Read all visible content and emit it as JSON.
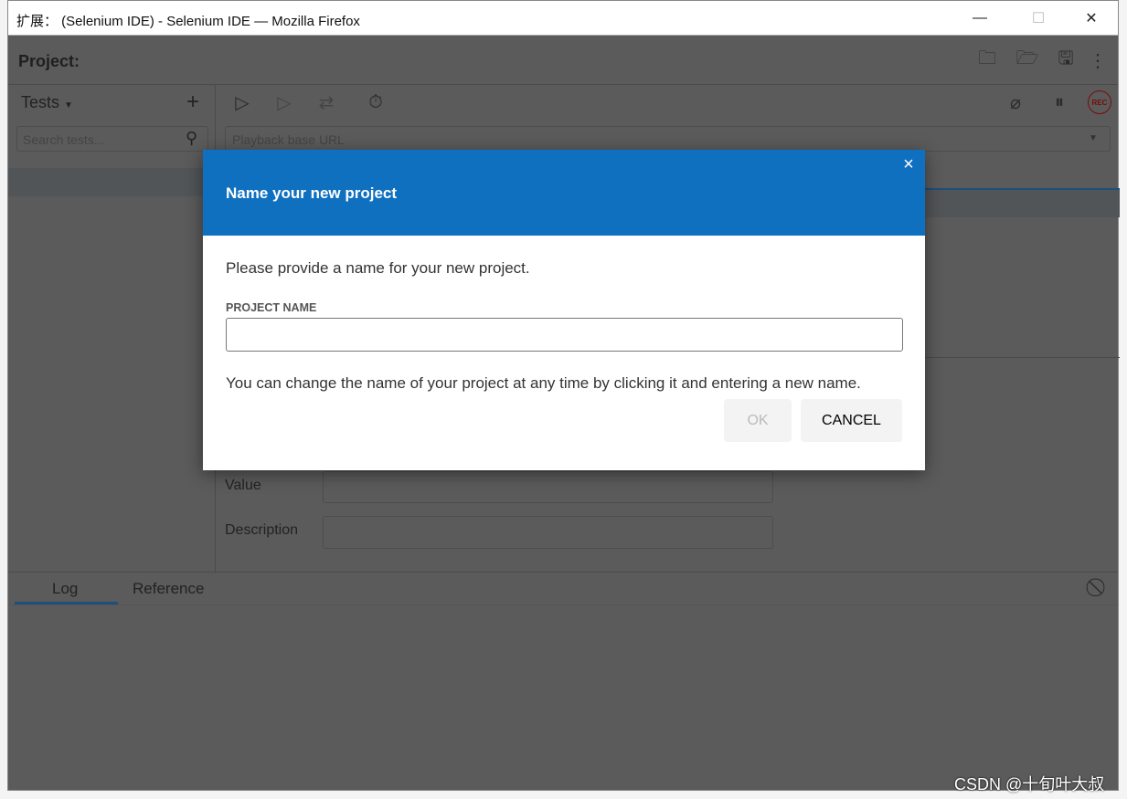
{
  "window": {
    "title": "扩展： (Selenium IDE) - Selenium IDE — Mozilla Firefox",
    "minimize": "—",
    "maximize": "☐",
    "close": "✕"
  },
  "header": {
    "project_label": "Project:",
    "icons": [
      "new-project-icon",
      "open-project-icon",
      "save-project-icon",
      "more-icon"
    ]
  },
  "tests": {
    "title": "Tests",
    "add": "+",
    "search_placeholder": "Search tests..."
  },
  "toolbar": {
    "icons": [
      "run-all-icon",
      "run-icon",
      "step-icon",
      "speed-icon",
      "disable-breakpoints-icon",
      "pause-icon",
      "record-icon"
    ],
    "rec": "REC"
  },
  "url": {
    "placeholder": "Playback base URL"
  },
  "command": {
    "value_label": "Value",
    "description_label": "Description"
  },
  "bottom": {
    "tabs": [
      {
        "label": "Log",
        "active": true
      },
      {
        "label": "Reference",
        "active": false
      }
    ]
  },
  "dialog": {
    "title": "Name your new project",
    "close": "×",
    "prompt": "Please provide a name for your new project.",
    "field_label": "PROJECT NAME",
    "field_value": "",
    "hint": "You can change the name of your project at any time by clicking it and entering a new name.",
    "ok": "OK",
    "cancel": "CANCEL",
    "ok_enabled": false
  },
  "colors": {
    "accent": "#1070c0",
    "overlay": "#5b5b5b",
    "record": "#7a0b0b"
  },
  "watermark": "CSDN @十旬叶大叔"
}
